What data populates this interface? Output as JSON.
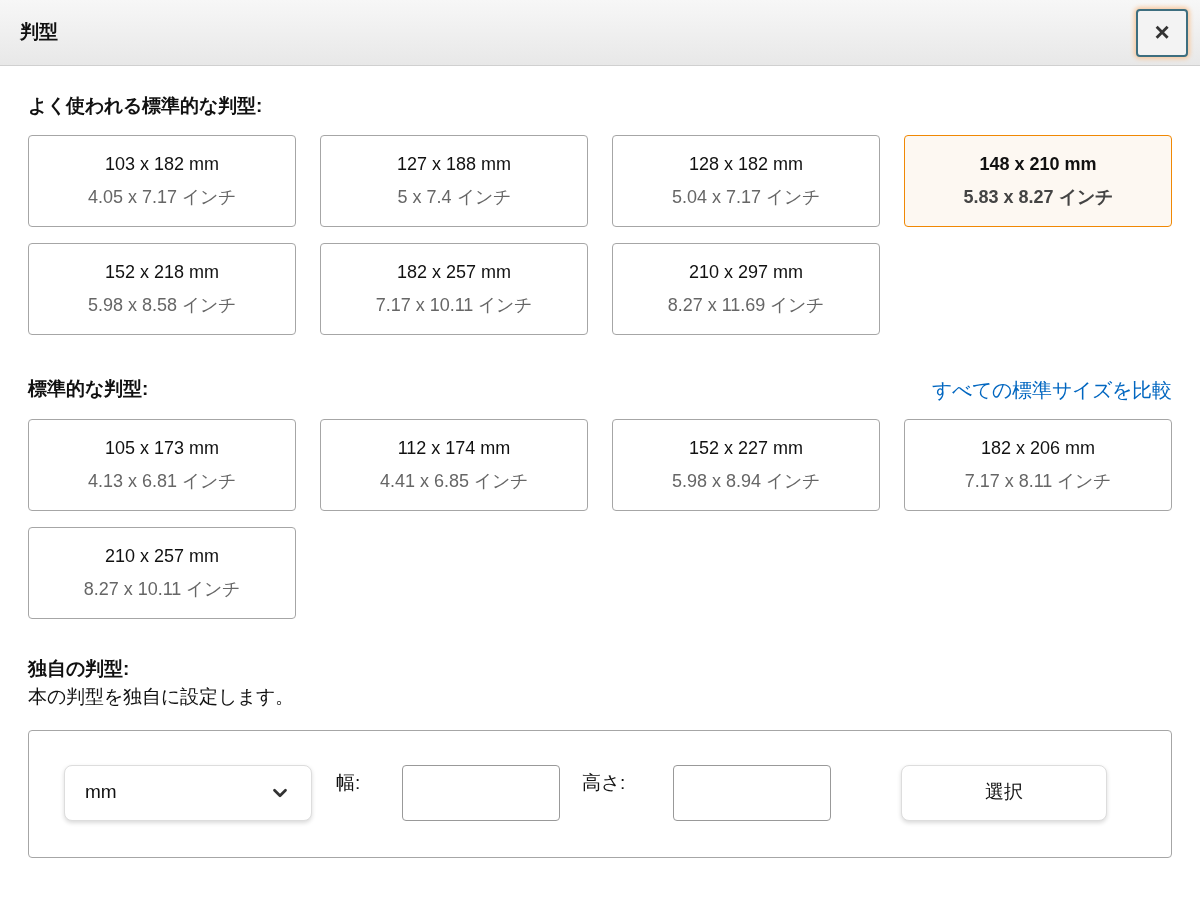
{
  "dialog": {
    "title": "判型",
    "close": "×"
  },
  "popular": {
    "heading": "よく使われる標準的な判型:",
    "sizes": [
      {
        "mm": "103 x 182 mm",
        "inches": "4.05 x 7.17 インチ",
        "selected": false
      },
      {
        "mm": "127 x 188 mm",
        "inches": "5 x 7.4 インチ",
        "selected": false
      },
      {
        "mm": "128 x 182 mm",
        "inches": "5.04 x 7.17 インチ",
        "selected": false
      },
      {
        "mm": "148 x 210 mm",
        "inches": "5.83 x 8.27 インチ",
        "selected": true
      },
      {
        "mm": "152 x 218 mm",
        "inches": "5.98 x 8.58 インチ",
        "selected": false
      },
      {
        "mm": "182 x 257 mm",
        "inches": "7.17 x 10.11 インチ",
        "selected": false
      },
      {
        "mm": "210 x 297 mm",
        "inches": "8.27 x 11.69 インチ",
        "selected": false
      }
    ]
  },
  "standard": {
    "heading": "標準的な判型:",
    "compare_link": "すべての標準サイズを比較",
    "sizes": [
      {
        "mm": "105 x 173 mm",
        "inches": "4.13 x 6.81 インチ",
        "selected": false
      },
      {
        "mm": "112 x 174 mm",
        "inches": "4.41 x 6.85 インチ",
        "selected": false
      },
      {
        "mm": "152 x 227 mm",
        "inches": "5.98 x 8.94 インチ",
        "selected": false
      },
      {
        "mm": "182 x 206 mm",
        "inches": "7.17 x 8.11 インチ",
        "selected": false
      },
      {
        "mm": "210 x 257 mm",
        "inches": "8.27 x 10.11 インチ",
        "selected": false
      }
    ]
  },
  "custom": {
    "heading": "独自の判型:",
    "description": "本の判型を独自に設定します。",
    "unit": "mm",
    "width_label": "幅:",
    "height_label": "高さ:",
    "button": "選択"
  }
}
